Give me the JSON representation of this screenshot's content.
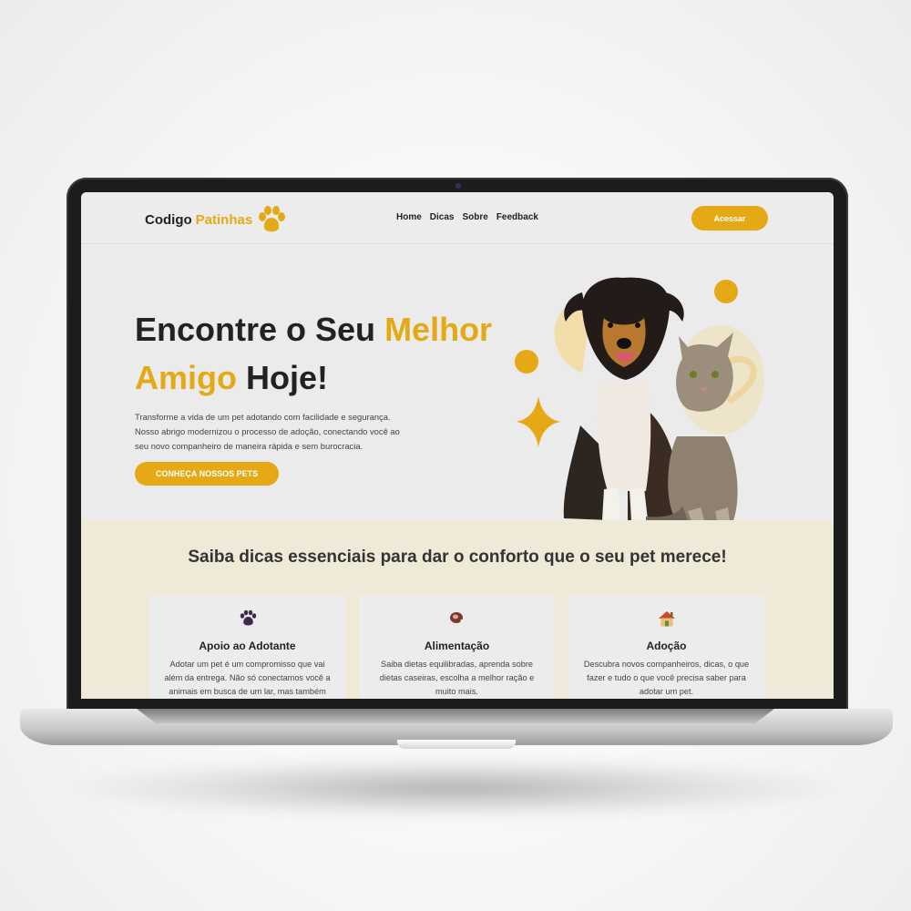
{
  "nav": {
    "brand_primary": "Codigo",
    "brand_accent": "Patinhas",
    "links": [
      "Home",
      "Dicas",
      "Sobre",
      "Feedback"
    ],
    "access_button": "Acessar"
  },
  "hero": {
    "title_line1_dark": "Encontre o Seu",
    "title_line1_highlight": "Melhor",
    "title_line2_highlight": "Amigo",
    "title_line2_dark": "Hoje!",
    "description_lines": [
      "Transforme a vida de um pet adotando com facilidade e segurança.",
      "Nosso abrigo modernizou o processo de adoção, conectando você ao",
      "seu novo companheiro de maneira rápida e sem burocracia."
    ],
    "cta_button": "CONHEÇA NOSSOS PETS"
  },
  "tips": {
    "heading": "Saiba dicas essenciais para dar o conforto que o seu pet merece!",
    "cards": [
      {
        "icon": "paw-prints-icon",
        "title": "Apoio ao Adotante",
        "lines": [
          "Adotar um pet é um compromisso que vai",
          "além da entrega. Não só conectamos você a",
          "animais em busca de um lar, mas também"
        ]
      },
      {
        "icon": "meat-icon",
        "title": "Alimentação",
        "lines": [
          "Saiba dietas equilibradas, aprenda sobre",
          "dietas caseiras, escolha a melhor ração e",
          "muito mais."
        ]
      },
      {
        "icon": "house-icon",
        "title": "Adoção",
        "lines": [
          "Descubra novos companheiros, dicas, o que",
          "fazer e tudo o que você precisa saber para",
          "adotar um pet."
        ]
      }
    ]
  },
  "colors": {
    "accent": "#e4a915",
    "tips_background": "#efe9d8",
    "page_background": "#ebebeb"
  }
}
